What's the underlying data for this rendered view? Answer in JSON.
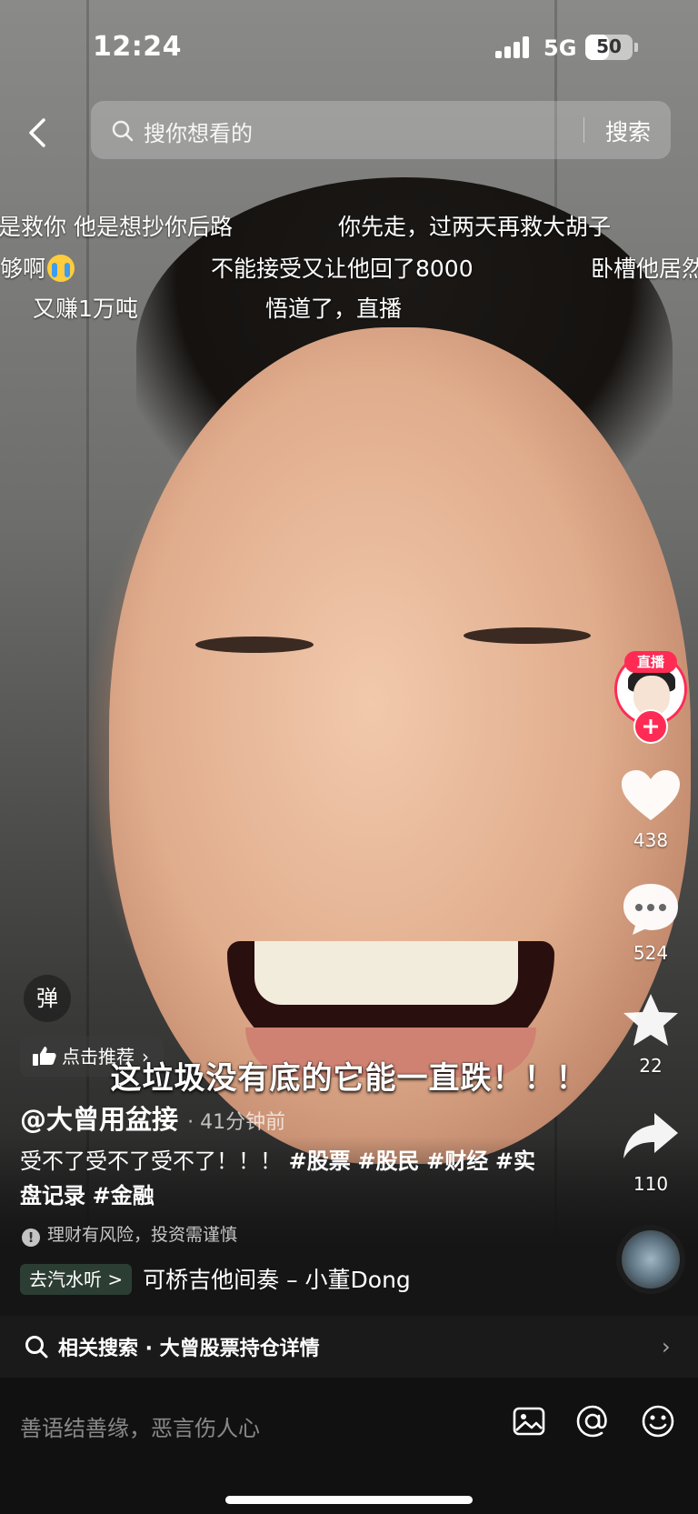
{
  "status_bar": {
    "time": "12:24",
    "network": "5G",
    "battery": "50",
    "battery_level": 0.5
  },
  "search": {
    "placeholder": "搜你想看的",
    "button_label": "搜索"
  },
  "danmaku": [
    "是救你 他是想抄你后路",
    "你先走，过两天再救大胡子",
    "够啊",
    "不能接受又让他回了8000",
    "卧槽他居然",
    "又赚1万吨",
    "悟道了，直播"
  ],
  "actions": {
    "live_badge": "直播",
    "likes": "438",
    "comments": "524",
    "favorites": "22",
    "shares": "110"
  },
  "video_caption": "这垃圾没有底的它能一直跌！！！",
  "info": {
    "danmaku_toggle": "弹",
    "recommend_label": "点击推荐",
    "author": "@大曾用盆接",
    "timestamp": "· 41分钟前",
    "description_text": "受不了受不了受不了！！！ ",
    "hashtags": [
      "#股票",
      "#股民",
      "#财经",
      "#实盘记录",
      "#金融"
    ],
    "risk_note": "理财有风险，投资需谨慎",
    "qishui_label": "去汽水听 >",
    "music_title": "可桥吉他间奏 – 小董Dong"
  },
  "related_search": {
    "label": "相关搜索 · 大曾股票持仓详情"
  },
  "comment_bar": {
    "placeholder": "善语结善缘，恶言伤人心"
  },
  "icons": {
    "back": "chevron-left-icon",
    "search": "search-icon",
    "like": "heart-icon",
    "comment": "comment-bubble-icon",
    "favorite": "star-icon",
    "share": "share-arrow-icon",
    "image": "image-icon",
    "mention": "at-sign-icon",
    "emoji": "emoji-icon"
  },
  "colors": {
    "accent": "#fe2c55",
    "comment_bar_bg": "#111111",
    "related_bg": "#1a1a1a"
  }
}
